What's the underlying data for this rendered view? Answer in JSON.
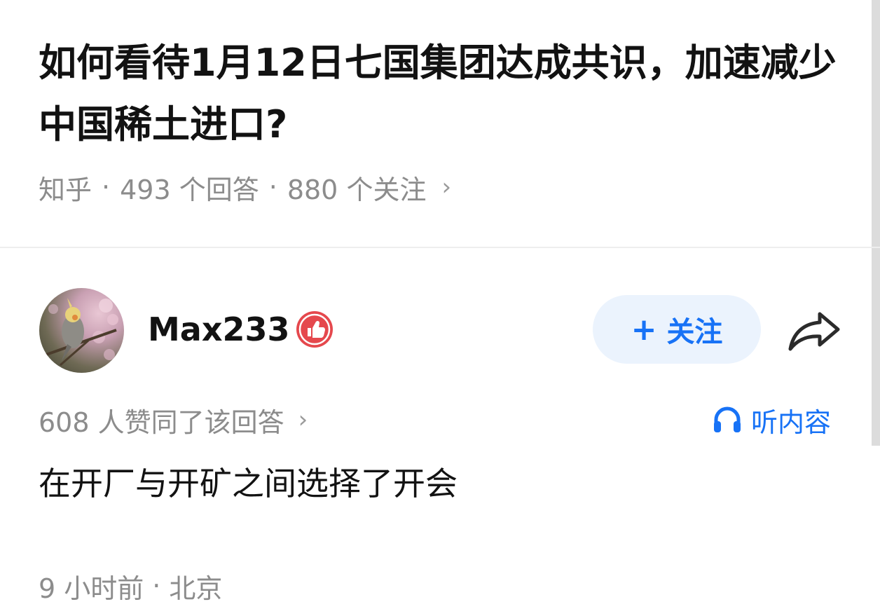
{
  "question": {
    "title": "如何看待1月12日七国集团达成共识，加速减少中国稀土进口?",
    "source": "知乎",
    "answer_count": "493 个回答",
    "follower_count": "880 个关注",
    "separator": "·",
    "chevron": "›"
  },
  "author": {
    "name": "Max233",
    "avatar_icon": "avatar-bird-photo",
    "badge_icon": "thumbs-up-badge-icon",
    "badge_color": "#e5484d"
  },
  "actions": {
    "follow_plus": "+",
    "follow_label": "关注",
    "share_icon": "share-arrow-icon",
    "listen_icon": "headphones-icon",
    "listen_label": "听内容",
    "accent_color": "#1772f6"
  },
  "answer": {
    "vote_text": "608 人赞同了该回答",
    "chevron": "›",
    "content": "在开厂与开矿之间选择了开会",
    "time": "9 小时前",
    "separator": "·",
    "location": "北京"
  }
}
